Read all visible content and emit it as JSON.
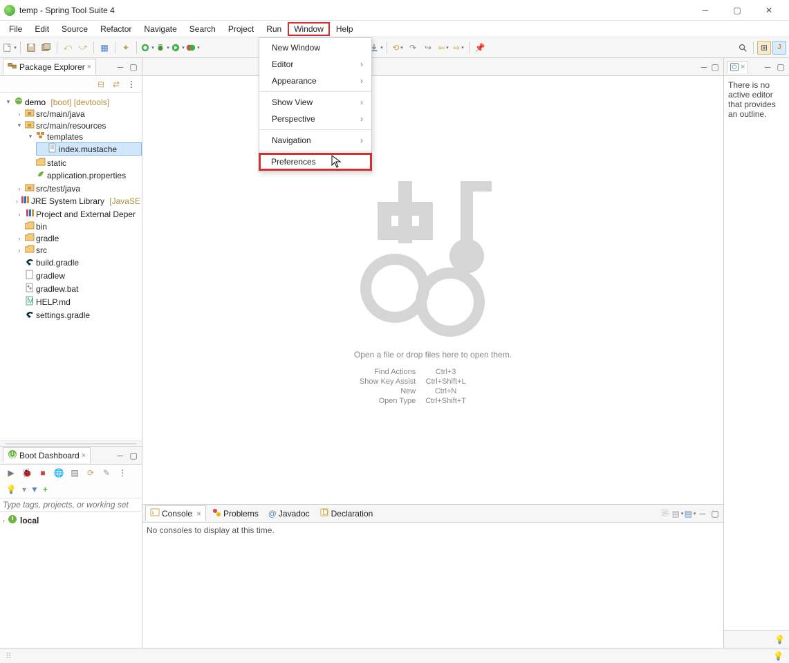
{
  "title": "temp - Spring Tool Suite 4",
  "menus": [
    "File",
    "Edit",
    "Source",
    "Refactor",
    "Navigate",
    "Search",
    "Project",
    "Run",
    "Window",
    "Help"
  ],
  "active_menu_index": 8,
  "dropdown": {
    "items": [
      {
        "label": "New Window",
        "sub": false
      },
      {
        "label": "Editor",
        "sub": true
      },
      {
        "label": "Appearance",
        "sub": true
      },
      {
        "sep": true
      },
      {
        "label": "Show View",
        "sub": true
      },
      {
        "label": "Perspective",
        "sub": true
      },
      {
        "sep": true
      },
      {
        "label": "Navigation",
        "sub": true
      },
      {
        "sep": true
      },
      {
        "label": "Preferences",
        "sub": false,
        "highlight": true
      }
    ]
  },
  "package_explorer": {
    "title": "Package Explorer",
    "tree": {
      "project": "demo",
      "project_decor": "[boot] [devtools]",
      "src_main_java": "src/main/java",
      "src_main_resources": "src/main/resources",
      "templates": "templates",
      "index_mustache": "index.mustache",
      "static": "static",
      "app_props": "application.properties",
      "src_test_java": "src/test/java",
      "jre_lib": "JRE System Library",
      "jre_lib_decor": "[JavaSE",
      "proj_ext": "Project and External Deper",
      "bin": "bin",
      "gradle": "gradle",
      "src": "src",
      "build_gradle": "build.gradle",
      "gradlew": "gradlew",
      "gradlew_bat": "gradlew.bat",
      "help_md": "HELP.md",
      "settings_gradle": "settings.gradle"
    }
  },
  "boot_dashboard": {
    "title": "Boot Dashboard",
    "filter_placeholder": "Type tags, projects, or working set",
    "local": "local"
  },
  "editor": {
    "placeholder": "Open a file or drop files here to open them.",
    "hints": [
      {
        "label": "Find Actions",
        "key": "Ctrl+3"
      },
      {
        "label": "Show Key Assist",
        "key": "Ctrl+Shift+L"
      },
      {
        "label": "New",
        "key": "Ctrl+N"
      },
      {
        "label": "Open Type",
        "key": "Ctrl+Shift+T"
      }
    ]
  },
  "bottom": {
    "tabs": [
      "Console",
      "Problems",
      "Javadoc",
      "Declaration"
    ],
    "console_msg": "No consoles to display at this time."
  },
  "outline": {
    "title_icon": "O",
    "message": "There is no active editor that provides an outline."
  }
}
